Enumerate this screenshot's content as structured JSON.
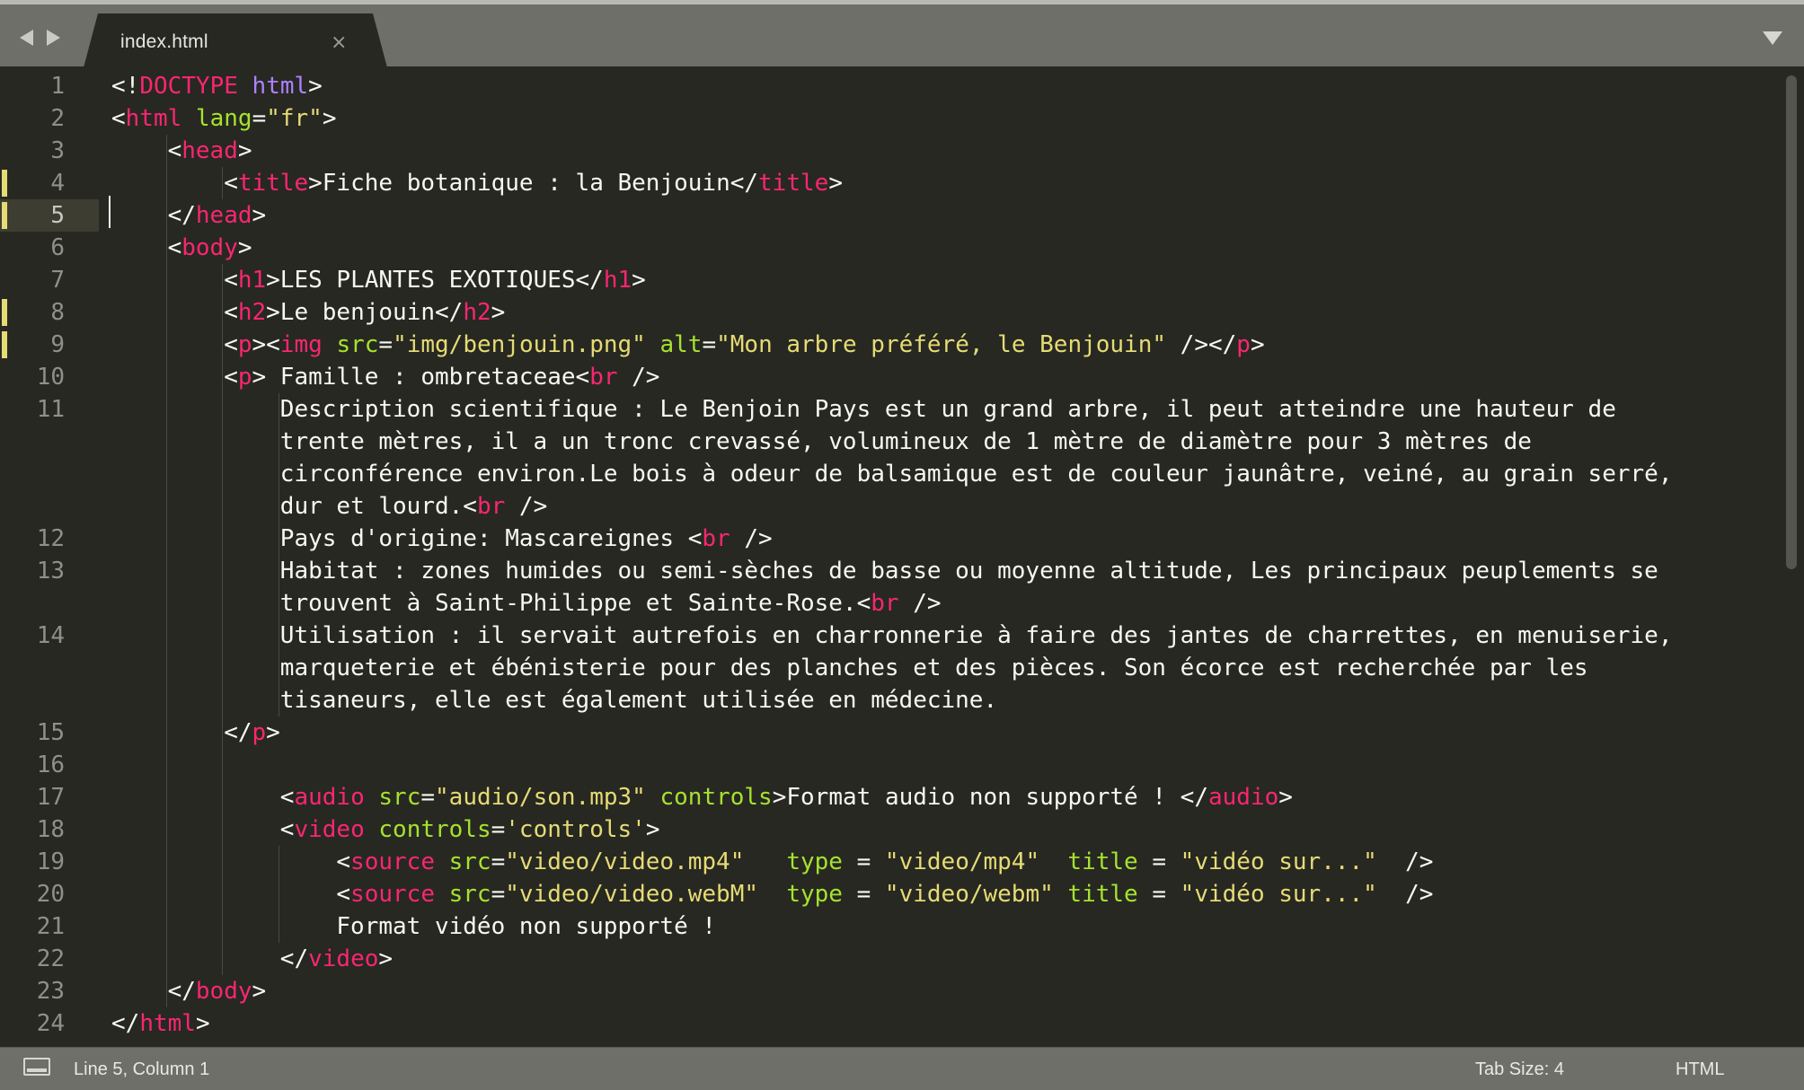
{
  "tab": {
    "filename": "index.html",
    "close_glyph": "×"
  },
  "editor": {
    "current_line": 5,
    "modified_lines": [
      4,
      5,
      8,
      9
    ],
    "lines": [
      {
        "n": "1",
        "row": 0,
        "indent": 0,
        "tokens": [
          [
            "pl",
            "<!"
          ],
          [
            "tg",
            "DOCTYPE"
          ],
          [
            "pl",
            " "
          ],
          [
            "kw",
            "html"
          ],
          [
            "pl",
            ">"
          ]
        ]
      },
      {
        "n": "2",
        "row": 1,
        "indent": 0,
        "tokens": [
          [
            "pl",
            "<"
          ],
          [
            "tg",
            "html"
          ],
          [
            "pl",
            " "
          ],
          [
            "at",
            "lang"
          ],
          [
            "pl",
            "="
          ],
          [
            "st",
            "\"fr\""
          ],
          [
            "pl",
            ">"
          ]
        ]
      },
      {
        "n": "3",
        "row": 2,
        "indent": 1,
        "tokens": [
          [
            "pl",
            "<"
          ],
          [
            "tg",
            "head"
          ],
          [
            "pl",
            ">"
          ]
        ]
      },
      {
        "n": "4",
        "row": 3,
        "indent": 2,
        "tokens": [
          [
            "pl",
            "<"
          ],
          [
            "tg",
            "title"
          ],
          [
            "pl",
            ">Fiche botanique : la Benjouin</"
          ],
          [
            "tg",
            "title"
          ],
          [
            "pl",
            ">"
          ]
        ]
      },
      {
        "n": "5",
        "row": 4,
        "indent": 1,
        "tokens": [
          [
            "pl",
            "</"
          ],
          [
            "tg",
            "head"
          ],
          [
            "pl",
            ">"
          ]
        ]
      },
      {
        "n": "6",
        "row": 5,
        "indent": 1,
        "tokens": [
          [
            "pl",
            "<"
          ],
          [
            "tg",
            "body"
          ],
          [
            "pl",
            ">"
          ]
        ]
      },
      {
        "n": "7",
        "row": 6,
        "indent": 2,
        "tokens": [
          [
            "pl",
            "<"
          ],
          [
            "tg",
            "h1"
          ],
          [
            "pl",
            ">LES PLANTES EXOTIQUES</"
          ],
          [
            "tg",
            "h1"
          ],
          [
            "pl",
            ">"
          ]
        ]
      },
      {
        "n": "8",
        "row": 7,
        "indent": 2,
        "tokens": [
          [
            "pl",
            "<"
          ],
          [
            "tg",
            "h2"
          ],
          [
            "pl",
            ">Le benjouin</"
          ],
          [
            "tg",
            "h2"
          ],
          [
            "pl",
            ">"
          ]
        ]
      },
      {
        "n": "9",
        "row": 8,
        "indent": 2,
        "tokens": [
          [
            "pl",
            "<"
          ],
          [
            "tg",
            "p"
          ],
          [
            "pl",
            "><"
          ],
          [
            "tg",
            "img"
          ],
          [
            "pl",
            " "
          ],
          [
            "at",
            "src"
          ],
          [
            "pl",
            "="
          ],
          [
            "st",
            "\"img/benjouin.png\""
          ],
          [
            "pl",
            " "
          ],
          [
            "at",
            "alt"
          ],
          [
            "pl",
            "="
          ],
          [
            "st",
            "\"Mon arbre préféré, le Benjouin\""
          ],
          [
            "pl",
            " /></"
          ],
          [
            "tg",
            "p"
          ],
          [
            "pl",
            ">"
          ]
        ]
      },
      {
        "n": "10",
        "row": 9,
        "indent": 2,
        "tokens": [
          [
            "pl",
            "<"
          ],
          [
            "tg",
            "p"
          ],
          [
            "pl",
            "> Famille : ombretaceae<"
          ],
          [
            "tg",
            "br"
          ],
          [
            "pl",
            " />"
          ]
        ]
      },
      {
        "n": "11",
        "row": 10,
        "indent": 3,
        "tokens": [
          [
            "pl",
            "Description scientifique : Le Benjoin Pays est un grand arbre, il peut atteindre une hauteur de"
          ]
        ]
      },
      {
        "n": "",
        "row": 11,
        "indent": 3,
        "tokens": [
          [
            "pl",
            "trente mètres, il a un tronc crevassé, volumineux de 1 mètre de diamètre pour 3 mètres de"
          ]
        ]
      },
      {
        "n": "",
        "row": 12,
        "indent": 3,
        "tokens": [
          [
            "pl",
            "circonférence environ.Le bois à odeur de balsamique est de couleur jaunâtre, veiné, au grain serré,"
          ]
        ]
      },
      {
        "n": "",
        "row": 13,
        "indent": 3,
        "tokens": [
          [
            "pl",
            "dur et lourd.<"
          ],
          [
            "tg",
            "br"
          ],
          [
            "pl",
            " />"
          ]
        ]
      },
      {
        "n": "12",
        "row": 14,
        "indent": 3,
        "tokens": [
          [
            "pl",
            "Pays d'origine: Mascareignes <"
          ],
          [
            "tg",
            "br"
          ],
          [
            "pl",
            " />"
          ]
        ]
      },
      {
        "n": "13",
        "row": 15,
        "indent": 3,
        "tokens": [
          [
            "pl",
            "Habitat : zones humides ou semi-sèches de basse ou moyenne altitude, Les principaux peuplements se"
          ]
        ]
      },
      {
        "n": "",
        "row": 16,
        "indent": 3,
        "tokens": [
          [
            "pl",
            "trouvent à Saint-Philippe et Sainte-Rose.<"
          ],
          [
            "tg",
            "br"
          ],
          [
            "pl",
            " />"
          ]
        ]
      },
      {
        "n": "14",
        "row": 17,
        "indent": 3,
        "tokens": [
          [
            "pl",
            "Utilisation : il servait autrefois en charronnerie à faire des jantes de charrettes, en menuiserie,"
          ]
        ]
      },
      {
        "n": "",
        "row": 18,
        "indent": 3,
        "tokens": [
          [
            "pl",
            "marqueterie et ébénisterie pour des planches et des pièces. Son écorce est recherchée par les"
          ]
        ]
      },
      {
        "n": "",
        "row": 19,
        "indent": 3,
        "tokens": [
          [
            "pl",
            "tisaneurs, elle est également utilisée en médecine."
          ]
        ]
      },
      {
        "n": "15",
        "row": 20,
        "indent": 2,
        "tokens": [
          [
            "pl",
            "</"
          ],
          [
            "tg",
            "p"
          ],
          [
            "pl",
            ">"
          ]
        ]
      },
      {
        "n": "16",
        "row": 21,
        "indent": 0,
        "tokens": []
      },
      {
        "n": "17",
        "row": 22,
        "indent": 3,
        "tokens": [
          [
            "pl",
            "<"
          ],
          [
            "tg",
            "audio"
          ],
          [
            "pl",
            " "
          ],
          [
            "at",
            "src"
          ],
          [
            "pl",
            "="
          ],
          [
            "st",
            "\"audio/son.mp3\""
          ],
          [
            "pl",
            " "
          ],
          [
            "at",
            "controls"
          ],
          [
            "pl",
            ">Format audio non supporté ! </"
          ],
          [
            "tg",
            "audio"
          ],
          [
            "pl",
            ">"
          ]
        ]
      },
      {
        "n": "18",
        "row": 23,
        "indent": 3,
        "tokens": [
          [
            "pl",
            "<"
          ],
          [
            "tg",
            "video"
          ],
          [
            "pl",
            " "
          ],
          [
            "at",
            "controls"
          ],
          [
            "pl",
            "="
          ],
          [
            "st",
            "'controls'"
          ],
          [
            "pl",
            ">"
          ]
        ]
      },
      {
        "n": "19",
        "row": 24,
        "indent": 4,
        "tokens": [
          [
            "pl",
            "<"
          ],
          [
            "tg",
            "source"
          ],
          [
            "pl",
            " "
          ],
          [
            "at",
            "src"
          ],
          [
            "pl",
            "="
          ],
          [
            "st",
            "\"video/video.mp4\""
          ],
          [
            "pl",
            "   "
          ],
          [
            "at",
            "type"
          ],
          [
            "pl",
            " = "
          ],
          [
            "st",
            "\"video/mp4\""
          ],
          [
            "pl",
            "  "
          ],
          [
            "at",
            "title"
          ],
          [
            "pl",
            " = "
          ],
          [
            "st",
            "\"vidéo sur...\""
          ],
          [
            "pl",
            "  />"
          ]
        ]
      },
      {
        "n": "20",
        "row": 25,
        "indent": 4,
        "tokens": [
          [
            "pl",
            "<"
          ],
          [
            "tg",
            "source"
          ],
          [
            "pl",
            " "
          ],
          [
            "at",
            "src"
          ],
          [
            "pl",
            "="
          ],
          [
            "st",
            "\"video/video.webM\""
          ],
          [
            "pl",
            "  "
          ],
          [
            "at",
            "type"
          ],
          [
            "pl",
            " = "
          ],
          [
            "st",
            "\"video/webm\""
          ],
          [
            "pl",
            " "
          ],
          [
            "at",
            "title"
          ],
          [
            "pl",
            " = "
          ],
          [
            "st",
            "\"vidéo sur...\""
          ],
          [
            "pl",
            "  />"
          ]
        ]
      },
      {
        "n": "21",
        "row": 26,
        "indent": 4,
        "tokens": [
          [
            "pl",
            "Format vidéo non supporté !"
          ]
        ]
      },
      {
        "n": "22",
        "row": 27,
        "indent": 3,
        "tokens": [
          [
            "pl",
            "</"
          ],
          [
            "tg",
            "video"
          ],
          [
            "pl",
            ">"
          ]
        ]
      },
      {
        "n": "23",
        "row": 28,
        "indent": 1,
        "tokens": [
          [
            "pl",
            "</"
          ],
          [
            "tg",
            "body"
          ],
          [
            "pl",
            ">"
          ]
        ]
      },
      {
        "n": "24",
        "row": 29,
        "indent": 0,
        "tokens": [
          [
            "pl",
            "</"
          ],
          [
            "tg",
            "html"
          ],
          [
            "pl",
            ">"
          ]
        ]
      }
    ]
  },
  "status": {
    "position": "Line 5, Column 1",
    "tab_size": "Tab Size: 4",
    "syntax": "HTML"
  },
  "theme": {
    "background": "#272822",
    "chrome": "#6f6f6a",
    "tag": "#f92672",
    "attribute": "#a6e22e",
    "string": "#e6db74",
    "keyword": "#ae81ff",
    "text": "#f8f8f2",
    "modified_marker": "#e6db74"
  }
}
